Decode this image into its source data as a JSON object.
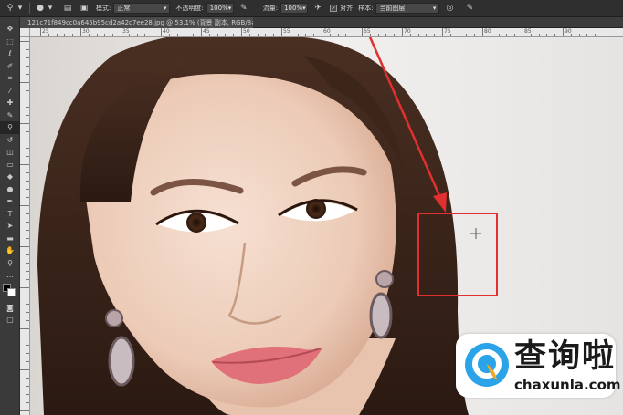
{
  "options_bar": {
    "mode_label": "模式:",
    "mode_value": "正常",
    "opacity_label": "不透明度:",
    "opacity_value": "100%",
    "flow_label": "流量:",
    "flow_value": "100%",
    "align_label": "对齐",
    "sample_label": "样本:",
    "sample_value": "当前图层"
  },
  "document_tab": {
    "title": "121c71f849cc0a645b95cd2a42c7ee28.jpg @ 53.1% (背景 副本, RGB/8#) *"
  },
  "ruler": {
    "h_labels": [
      "25",
      "30",
      "35",
      "40",
      "45",
      "50",
      "55",
      "60",
      "65",
      "70",
      "75",
      "80",
      "85",
      "90"
    ]
  },
  "watermark": {
    "brand_cn": "查询啦",
    "brand_en": "chaxunla.com"
  },
  "annotation": {
    "color": "#e0302f"
  },
  "tool_icons": [
    "move-icon",
    "marquee-icon",
    "lasso-icon",
    "quick-select-icon",
    "crop-icon",
    "eyedropper-icon",
    "healing-icon",
    "brush-icon",
    "clone-stamp-icon",
    "history-brush-icon",
    "eraser-icon",
    "gradient-icon",
    "blur-icon",
    "dodge-icon",
    "pen-icon",
    "type-icon",
    "path-select-icon",
    "shape-icon",
    "hand-icon",
    "zoom-icon"
  ]
}
